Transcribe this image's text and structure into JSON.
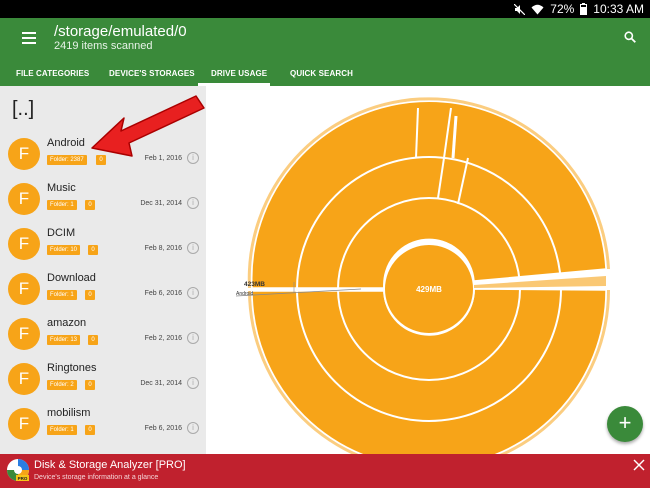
{
  "status": {
    "battery": "72%",
    "time": "10:33 AM"
  },
  "header": {
    "path": "/storage/emulated/0",
    "scanned": "2419 items scanned"
  },
  "tabs": [
    {
      "label": "FILE CATEGORIES"
    },
    {
      "label": "DEVICE'S STORAGES"
    },
    {
      "label": "DRIVE USAGE",
      "active": true
    },
    {
      "label": "QUICK SEARCH"
    }
  ],
  "list": {
    "up_label": "[..]",
    "items": [
      {
        "avatar": "F",
        "name": "Android",
        "folder": "Folder: 2387",
        "count": "0",
        "date": "Feb 1, 2016"
      },
      {
        "avatar": "F",
        "name": "Music",
        "folder": "Folder: 1",
        "count": "0",
        "date": "Dec 31, 2014"
      },
      {
        "avatar": "F",
        "name": "DCIM",
        "folder": "Folder: 10",
        "count": "0",
        "date": "Feb 8, 2016"
      },
      {
        "avatar": "F",
        "name": "Download",
        "folder": "Folder: 1",
        "count": "0",
        "date": "Feb 6, 2016"
      },
      {
        "avatar": "F",
        "name": "amazon",
        "folder": "Folder: 13",
        "count": "0",
        "date": "Feb 2, 2016"
      },
      {
        "avatar": "F",
        "name": "Ringtones",
        "folder": "Folder: 2",
        "count": "0",
        "date": "Dec 31, 2014"
      },
      {
        "avatar": "F",
        "name": "mobilism",
        "folder": "Folder: 1",
        "count": "0",
        "date": "Feb 6, 2016"
      }
    ]
  },
  "chart": {
    "center_label": "429MB",
    "side_value": "423MB",
    "side_label": "Android"
  },
  "fab": {
    "label": "+"
  },
  "ad": {
    "title": "Disk & Storage Analyzer [PRO]",
    "subtitle": "Device's storage information at a glance"
  },
  "colors": {
    "green": "#3a8a3a",
    "orange": "#f7a418",
    "ad_red": "#c0212e",
    "panel": "#eaeaea"
  }
}
